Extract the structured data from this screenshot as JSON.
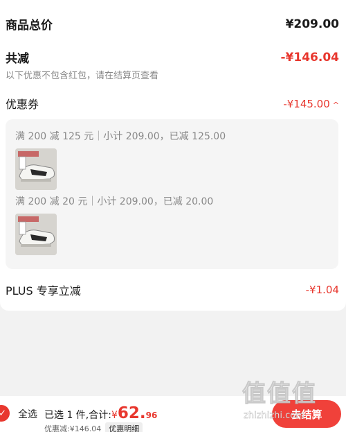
{
  "summary": {
    "goods_total_label": "商品总价",
    "goods_total_value": "¥209.00",
    "total_discount_label": "共减",
    "total_discount_value": "-¥146.04",
    "note": "以下优惠不包含红包，请在结算页查看"
  },
  "coupons": {
    "label": "优惠券",
    "value": "-¥145.00",
    "expanded": true,
    "items": [
      {
        "text": "满 200 减 125 元｜小计 209.00，已减 125.00"
      },
      {
        "text": "满 200 减 20 元｜小计 209.00，已减 20.00"
      }
    ]
  },
  "plus": {
    "label": "PLUS 专享立减",
    "value": "-¥1.04"
  },
  "bottom_bar": {
    "select_all": "全选",
    "selected_text": "已选 1 件,合计:",
    "currency": "¥",
    "pay_integer": "62.",
    "pay_decimal": "96",
    "discount_text": "优惠减:¥146.04",
    "detail_button": "优惠明细",
    "checkout_button": "去结算"
  },
  "watermark": {
    "glyphs": "值值值",
    "url": "zhizhizhi.com"
  },
  "colors": {
    "accent_red": "#e8372e",
    "button_red": "#f0413a",
    "background": "#f2f2f2"
  },
  "icons": [
    "check-circle-icon",
    "chevron-up-icon",
    "sneaker-thumbnail"
  ]
}
